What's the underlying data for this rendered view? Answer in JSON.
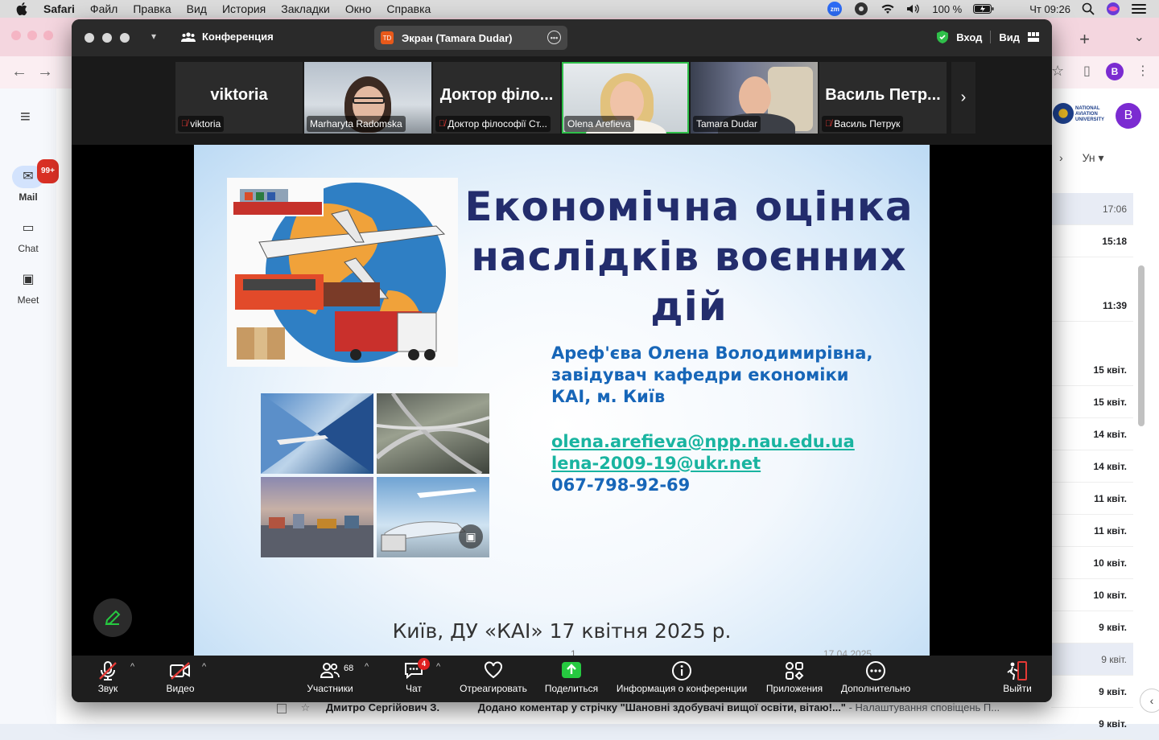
{
  "menubar": {
    "app": "Safari",
    "items": [
      "Файл",
      "Правка",
      "Вид",
      "История",
      "Закладки",
      "Окно",
      "Справка"
    ],
    "zoom_icon_label": "zm",
    "battery": "100 %",
    "clock": "Чт 09:26"
  },
  "gmail": {
    "rail": [
      {
        "label": "Mail",
        "badge": "99+"
      },
      {
        "label": "Chat"
      },
      {
        "label": "Meet"
      }
    ],
    "header_col": "Ун",
    "avatar_letter": "B",
    "logo_text": "NATIONAL AVIATION UNIVERSITY",
    "rows": [
      {
        "time": "17:06",
        "style": "hl"
      },
      {
        "time": "15:18",
        "style": "unread"
      },
      {
        "time": "11:39",
        "style": "unread"
      },
      {
        "time": "15 квіт.",
        "style": "unread"
      },
      {
        "time": "15 квіт.",
        "style": "unread"
      },
      {
        "time": "14 квіт.",
        "style": "unread"
      },
      {
        "time": "14 квіт.",
        "style": "unread"
      },
      {
        "time": "11 квіт.",
        "style": "unread"
      },
      {
        "time": "11 квіт.",
        "style": "unread"
      },
      {
        "time": "10 квіт.",
        "style": "unread"
      },
      {
        "time": "10 квіт.",
        "style": "unread"
      },
      {
        "time": "9 квіт.",
        "style": "unread"
      },
      {
        "time": "9 квіт.",
        "style": "hl"
      },
      {
        "time": "9 квіт.",
        "style": "unread"
      },
      {
        "time": "9 квіт.",
        "style": "unread"
      }
    ],
    "bottom_sender": "Дмитро Сергійович З.",
    "bottom_subject": "Додано коментар у стрічку \"Шановні здобувачі вищої освіти, вітаю!...\"",
    "bottom_snippet": " - Налаштування сповіщень П..."
  },
  "zoom": {
    "window_title": "Конференция",
    "share_badge": "TD",
    "share_pill": "Экран (Tamara Dudar)",
    "signin": "Вход",
    "view": "Вид",
    "participants": [
      {
        "big_name": "viktoria",
        "caption": "viktoria",
        "muted": true,
        "video": false
      },
      {
        "big_name": "",
        "caption": "Marharyta Radomska",
        "muted": false,
        "video": true
      },
      {
        "big_name": "Доктор філо...",
        "caption": "Доктор філософії Ст...",
        "muted": true,
        "video": false
      },
      {
        "big_name": "",
        "caption": "Olena Arefieva",
        "muted": false,
        "video": true,
        "active": true
      },
      {
        "big_name": "",
        "caption": "Tamara Dudar",
        "muted": false,
        "video": true
      },
      {
        "big_name": "Василь Петр...",
        "caption": "Василь Петрук",
        "muted": true,
        "video": false
      }
    ],
    "toolbar": {
      "audio": "Звук",
      "video": "Видео",
      "participants": "Участники",
      "participants_count": "68",
      "chat": "Чат",
      "chat_badge": "4",
      "react": "Отреагировать",
      "share": "Поделиться",
      "info": "Информация о конференции",
      "apps": "Приложения",
      "more": "Дополнительно",
      "leave": "Выйти"
    }
  },
  "slide": {
    "title_line1": "Економічна оцінка",
    "title_line2": "наслідків воєнних дій",
    "author_line1": "Ареф'єва Олена Володимирівна,",
    "author_line2": "завідувач кафедри економіки",
    "author_line3": "КАІ, м. Київ",
    "email1": "olena.arefieva@npp.nau.edu.ua",
    "email2": "lena-2009-19@ukr.net",
    "phone": "067-798-92-69",
    "footer": "Київ, ДУ «КАІ» 17 квітня 2025 р.",
    "page_number": "1",
    "date_footer": "17.04.2025"
  },
  "colors": {
    "zoom_bg": "#1a1a1a",
    "active_speaker": "#2fbf4a",
    "slide_title": "#232d6d",
    "slide_author": "#1766b8",
    "slide_link": "#19b4a0",
    "muted_red": "#e53935",
    "share_green": "#26c940"
  }
}
